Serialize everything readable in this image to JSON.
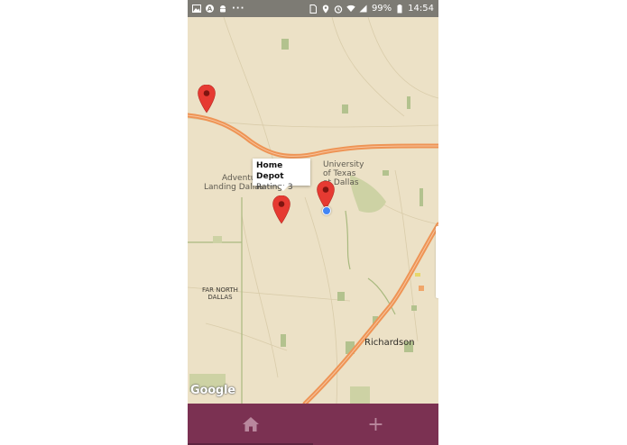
{
  "status_bar": {
    "battery": "99%",
    "time": "14:54",
    "overflow": "···",
    "left_icons": [
      "image-icon",
      "a-badge-icon",
      "android-icon"
    ],
    "right_icons": [
      "sim-icon",
      "location-icon",
      "alarm-icon",
      "wifi-icon",
      "signal-icon",
      "battery-icon"
    ]
  },
  "map": {
    "labels": {
      "university_1": "University",
      "university_2": "of Texas",
      "university_3": "at Dallas",
      "adventure_1": "Adventure",
      "adventure_2": "Landing Dallas",
      "far_north_1": "FAR NORTH",
      "far_north_2": "DALLAS",
      "richardson": "Richardson"
    },
    "attribution": "Google",
    "colors": {
      "land": "#ece1c6",
      "highway": "#ee9455",
      "park": "#b3c28e",
      "marker": "#e63a32",
      "my_location": "#4285f4"
    }
  },
  "info_window": {
    "title": "Home Depot",
    "rating": "Rating: 3"
  },
  "bottom_nav": {
    "home_icon": "home-icon",
    "add_icon": "plus-icon",
    "add_label": "+",
    "color": "#7b3152"
  }
}
